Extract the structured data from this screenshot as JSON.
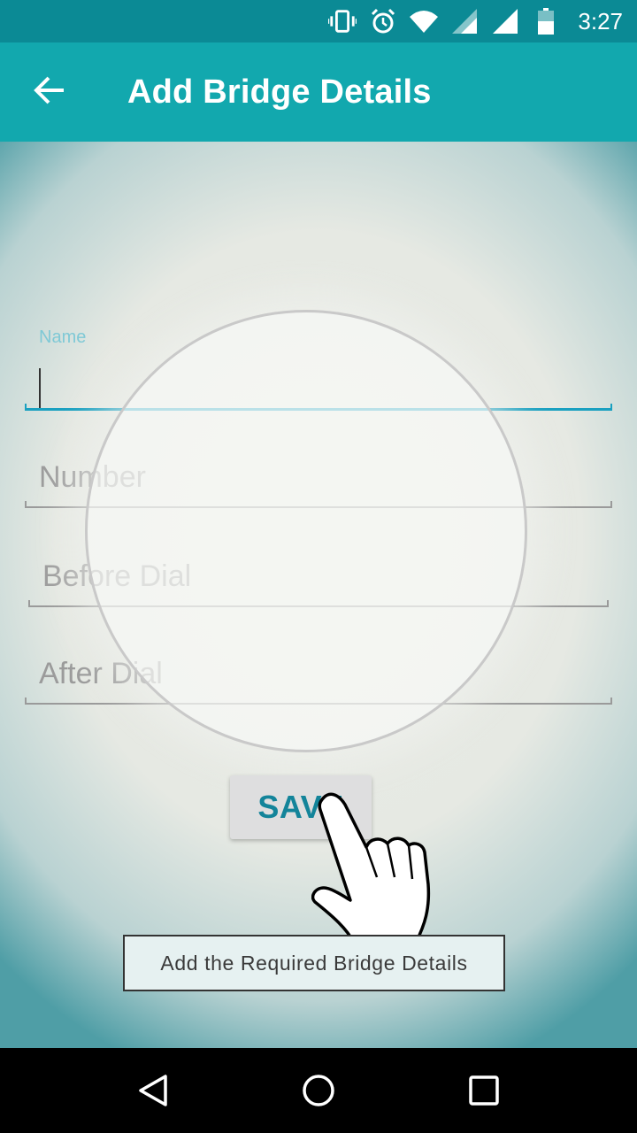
{
  "status_bar": {
    "time": "3:27",
    "icons": [
      "vibrate-icon",
      "alarm-icon",
      "wifi-icon",
      "signal-icon",
      "signal-icon",
      "battery-icon"
    ]
  },
  "app_bar": {
    "title": "Add Bridge Details",
    "back_icon": "arrow-left-icon"
  },
  "form": {
    "name": {
      "label": "Name",
      "value": ""
    },
    "number": {
      "placeholder": "Number",
      "value": ""
    },
    "before_dial": {
      "placeholder": "Before Dial",
      "value": ""
    },
    "after_dial": {
      "placeholder": "After Dial",
      "value": ""
    },
    "save_label": "SAVE"
  },
  "tutorial": {
    "tooltip": "Add the Required Bridge Details",
    "pointer_icon": "hand-pointer-icon"
  },
  "nav_bar": {
    "icons": [
      "back-triangle-icon",
      "home-circle-icon",
      "recents-square-icon"
    ]
  },
  "colors": {
    "status_bar": "#0b8a95",
    "app_bar": "#12a8ae",
    "accent": "#1aa0c0",
    "save_text": "#13849a"
  }
}
